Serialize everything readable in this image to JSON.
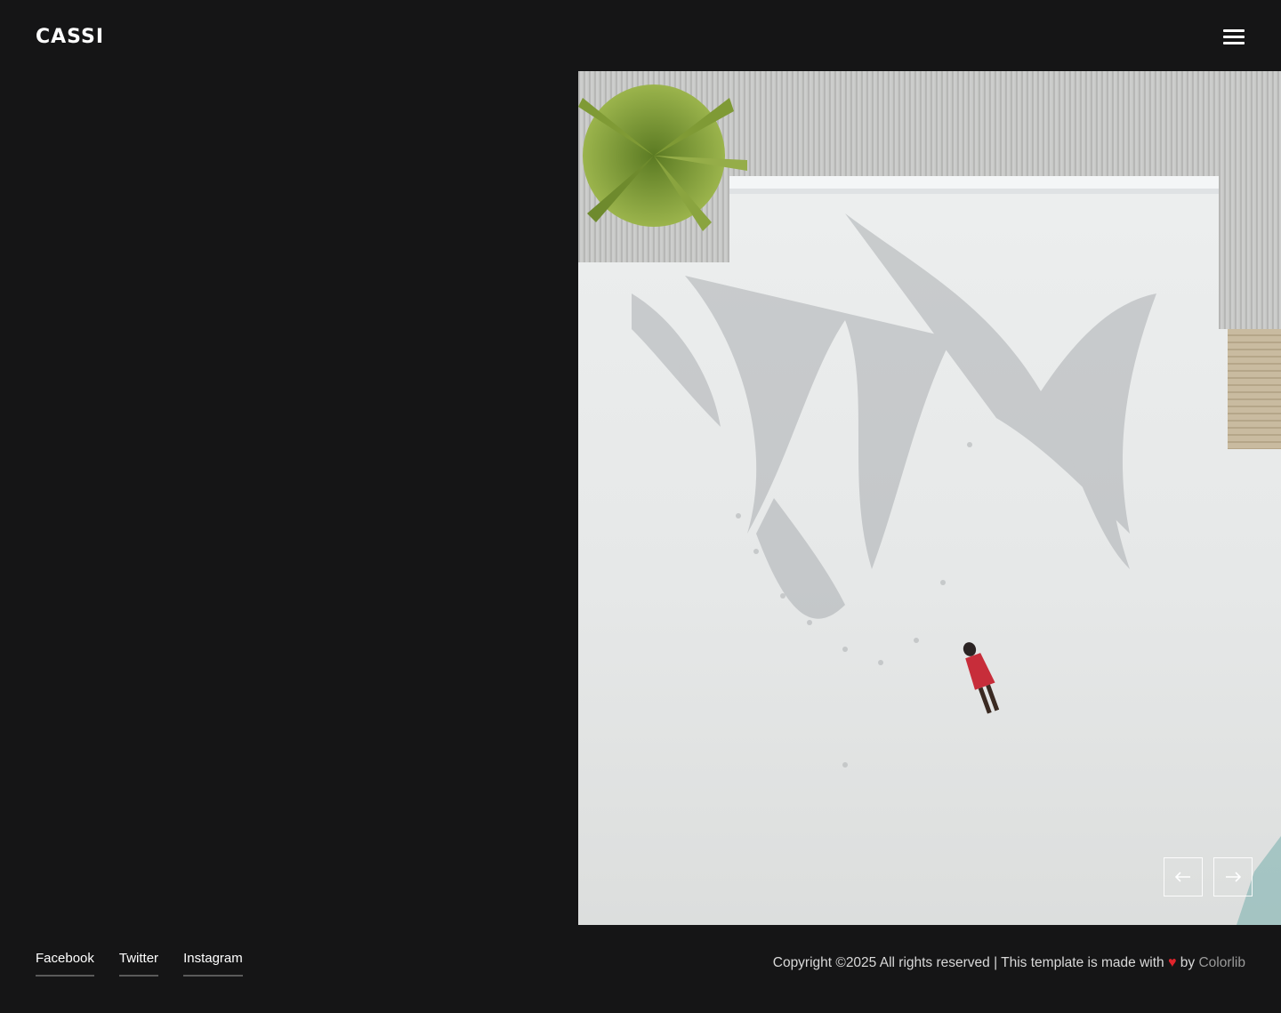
{
  "header": {
    "logo": "CASSI",
    "menu_icon": "hamburger-menu-icon"
  },
  "hero": {
    "image_description_icon": "aerial-beach-photo",
    "prev_icon": "arrow-left-icon",
    "next_icon": "arrow-right-icon"
  },
  "footer": {
    "social": [
      {
        "label": "Facebook"
      },
      {
        "label": "Twitter"
      },
      {
        "label": "Instagram"
      }
    ],
    "copyright_prefix": "Copyright ©2025 All rights reserved | This template is made with ",
    "heart_icon": "heart-icon",
    "copyright_by": " by ",
    "brand": "Colorlib"
  },
  "colors": {
    "background": "#151516",
    "accent_heart": "#e0242c"
  }
}
